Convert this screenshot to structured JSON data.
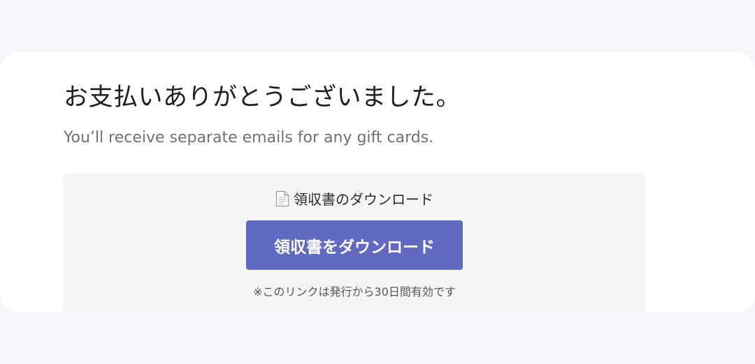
{
  "confirmation": {
    "title": "お支払いありがとうございました。",
    "subtitle": "You’ll receive separate emails for any gift cards."
  },
  "receipt": {
    "heading_icon": "document-icon",
    "heading": "領収書のダウンロード",
    "button_label": "領収書をダウンロード",
    "note": "※このリンクは発行から30日間有効です"
  },
  "colors": {
    "page_background": "#f6f6f9",
    "card_background": "#ffffff",
    "receipt_box_background": "#f5f5f5",
    "button_background": "#616ac1",
    "button_text": "#ffffff"
  }
}
